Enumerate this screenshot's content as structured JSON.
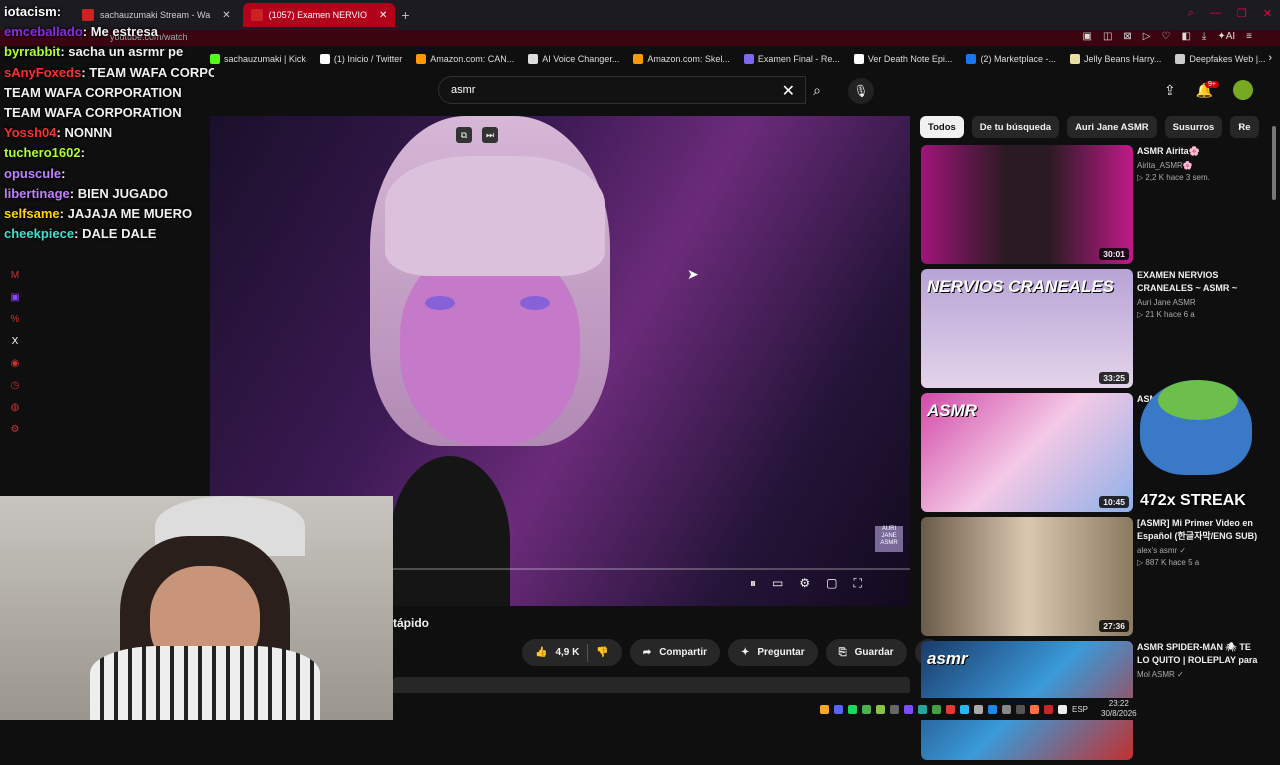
{
  "browser": {
    "tabs": [
      {
        "label": "sachauzumaki Stream - Wa",
        "active": false
      },
      {
        "label": "(1057) Examen NERVIO",
        "active": true
      }
    ],
    "url": "youtube.com/watch",
    "bookmarks": [
      {
        "label": "sachauzumaki | Kick",
        "color": "#53fc18"
      },
      {
        "label": "(1) Inicio / Twitter",
        "color": "#ffffff"
      },
      {
        "label": "Amazon.com: CAN...",
        "color": "#ff9900"
      },
      {
        "label": "AI Voice Changer...",
        "color": "#dddddd"
      },
      {
        "label": "Amazon.com: Skel...",
        "color": "#ff9900"
      },
      {
        "label": "Examen Final - Re...",
        "color": "#7b68ee"
      },
      {
        "label": "Ver Death Note Epi...",
        "color": "#ffffff"
      },
      {
        "label": "(2) Marketplace -...",
        "color": "#1877f2"
      },
      {
        "label": "Jelly Beans Harry...",
        "color": "#e8e0a0"
      },
      {
        "label": "Deepfakes Web |...",
        "color": "#cccccc"
      }
    ]
  },
  "chat": [
    {
      "user": "iotacism",
      "color": "#ffffff",
      "text": ""
    },
    {
      "user": "emceballado",
      "color": "#8a2be2",
      "text": "Me estresa"
    },
    {
      "user": "byrrabbit",
      "color": "#adff2f",
      "text": "sacha un asrmr pe"
    },
    {
      "user": "sAnyFoxeds",
      "color": "#ff3030",
      "text": "TEAM WAFA CORPORATION"
    },
    {
      "user": "",
      "color": "#ffffff",
      "text": "TEAM WAFA CORPORATION"
    },
    {
      "user": "",
      "color": "#ffffff",
      "text": "TEAM WAFA CORPORATION"
    },
    {
      "user": "Yossh04",
      "color": "#ff3030",
      "text": "NONNN"
    },
    {
      "user": "tuchero1602",
      "color": "#adff2f",
      "text": ""
    },
    {
      "user": "opuscule",
      "color": "#c080ff",
      "text": ""
    },
    {
      "user": "libertinage",
      "color": "#c080ff",
      "text": "BIEN JUGADO"
    },
    {
      "user": "selfsame",
      "color": "#ffd700",
      "text": "JAJAJA ME MUERO"
    },
    {
      "user": "cheekpiece",
      "color": "#40e0d0",
      "text": "DALE DALE"
    }
  ],
  "youtube": {
    "search_value": "asmr",
    "notif_count": "9+",
    "video_title_fragment": "tápido",
    "likes": "4,9 K",
    "share_label": "Compartir",
    "ask_label": "Preguntar",
    "save_label": "Guardar",
    "watermark": "AURI JANE ASMR",
    "chips": [
      {
        "label": "Todos",
        "selected": true
      },
      {
        "label": "De tu búsqueda",
        "selected": false
      },
      {
        "label": "Auri Jane ASMR",
        "selected": false
      },
      {
        "label": "Susurros",
        "selected": false
      },
      {
        "label": "Re",
        "selected": false
      }
    ],
    "recommendations": [
      {
        "title": "ASMR Airita🌸",
        "channel": "Airita_ASMR🌸",
        "meta": "▷ 2,2 K  hace 3 sem.",
        "duration": "30:01",
        "thumb": "linear-gradient(90deg,#a0157a,#2a1a22 40%,#2a1a22 60%,#c01a8a)",
        "thumb_text": ""
      },
      {
        "title": "EXAMEN NERVIOS CRANEALES ~ ASMR ~ CRANIAL NERVE EXAM ♡ ...",
        "channel": "Auri Jane ASMR",
        "meta": "▷ 21 K  hace 6 a",
        "duration": "33:25",
        "thumb": "linear-gradient(180deg,#b7a3d6,#e3d4ea)",
        "thumb_text": "NERVIOS CRANEALES"
      },
      {
        "title": "ASMR... YOGA",
        "channel": "",
        "meta": "",
        "duration": "10:45",
        "thumb": "linear-gradient(135deg,#d24aa8,#f4c9e6 50%,#8fb0e8)",
        "thumb_text": "ASMR"
      },
      {
        "title": "[ASMR] Mi Primer Video en Español (한글자막/ENG SUB)",
        "channel": "alex's asmr ✓",
        "meta": "▷ 887 K  hace 5 a",
        "duration": "27:36",
        "thumb": "linear-gradient(90deg,#6a5a48,#d9c9b1 50%,#8a7a62)",
        "thumb_text": ""
      },
      {
        "title": "ASMR SPIDER-MAN 🕷 TE LO QUITO | ROLEPLAY para DORMIR 😴",
        "channel": "Mol ASMR ✓",
        "meta": "",
        "duration": "",
        "thumb": "linear-gradient(135deg,#1a3a6a,#3a9ad8 50%,#c23030)",
        "thumb_text": "asmr"
      }
    ]
  },
  "overlay": {
    "streak": "472x STREAK"
  },
  "taskbar": {
    "lang": "ESP",
    "time": "23:22",
    "date": "30/8/2026"
  }
}
